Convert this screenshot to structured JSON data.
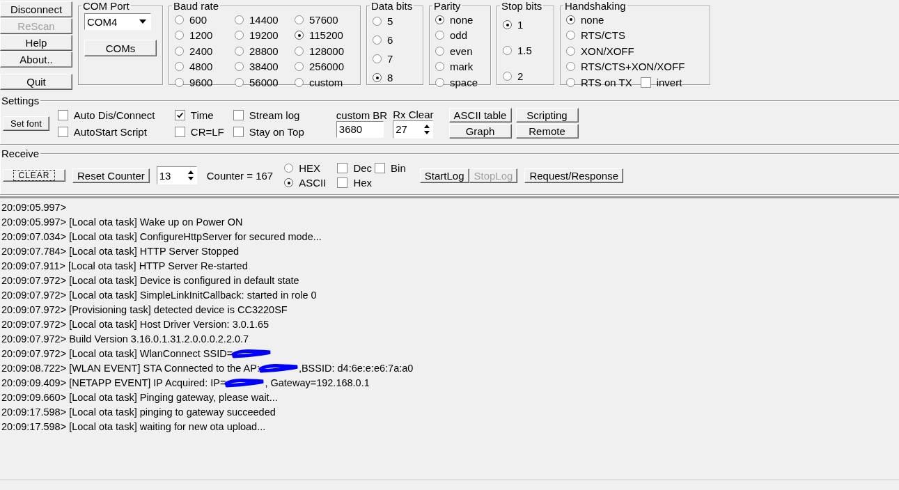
{
  "left_buttons": [
    {
      "label": "Disconnect",
      "disabled": false
    },
    {
      "label": "ReScan",
      "disabled": true
    },
    {
      "label": "Help",
      "disabled": false
    },
    {
      "label": "About..",
      "disabled": false
    },
    {
      "label": "Quit",
      "disabled": false
    }
  ],
  "com_port": {
    "title": "COM Port",
    "value": "COM4",
    "button": "COMs"
  },
  "baud_rate": {
    "title": "Baud rate",
    "options": [
      {
        "label": "600",
        "selected": false
      },
      {
        "label": "14400",
        "selected": false
      },
      {
        "label": "57600",
        "selected": false
      },
      {
        "label": "1200",
        "selected": false
      },
      {
        "label": "19200",
        "selected": false
      },
      {
        "label": "115200",
        "selected": true
      },
      {
        "label": "2400",
        "selected": false
      },
      {
        "label": "28800",
        "selected": false
      },
      {
        "label": "128000",
        "selected": false
      },
      {
        "label": "4800",
        "selected": false
      },
      {
        "label": "38400",
        "selected": false
      },
      {
        "label": "256000",
        "selected": false
      },
      {
        "label": "9600",
        "selected": false
      },
      {
        "label": "56000",
        "selected": false
      },
      {
        "label": "custom",
        "selected": false
      }
    ]
  },
  "data_bits": {
    "title": "Data bits",
    "options": [
      {
        "label": "5",
        "selected": false
      },
      {
        "label": "6",
        "selected": false
      },
      {
        "label": "7",
        "selected": false
      },
      {
        "label": "8",
        "selected": true
      }
    ]
  },
  "parity": {
    "title": "Parity",
    "options": [
      {
        "label": "none",
        "selected": true
      },
      {
        "label": "odd",
        "selected": false
      },
      {
        "label": "even",
        "selected": false
      },
      {
        "label": "mark",
        "selected": false
      },
      {
        "label": "space",
        "selected": false
      }
    ]
  },
  "stop_bits": {
    "title": "Stop bits",
    "options": [
      {
        "label": "1",
        "selected": true
      },
      {
        "label": "1.5",
        "selected": false
      },
      {
        "label": "2",
        "selected": false
      }
    ]
  },
  "handshaking": {
    "title": "Handshaking",
    "options": [
      {
        "label": "none",
        "selected": true
      },
      {
        "label": "RTS/CTS",
        "selected": false
      },
      {
        "label": "XON/XOFF",
        "selected": false
      },
      {
        "label": "RTS/CTS+XON/XOFF",
        "selected": false
      },
      {
        "label": "RTS on TX",
        "selected": false
      }
    ],
    "invert": {
      "label": "invert",
      "checked": false
    }
  },
  "settings": {
    "title": "Settings",
    "set_font": "Set font",
    "checkboxes": [
      {
        "label": "Auto Dis/Connect",
        "checked": false
      },
      {
        "label": "AutoStart Script",
        "checked": false
      },
      {
        "label": "Time",
        "checked": true
      },
      {
        "label": "CR=LF",
        "checked": false
      },
      {
        "label": "Stream log",
        "checked": false
      },
      {
        "label": "Stay on Top",
        "checked": false
      }
    ],
    "custom_br": {
      "label": "custom BR",
      "value": "3680"
    },
    "rx_clear": {
      "label": "Rx Clear",
      "value": "27"
    },
    "buttons": [
      "ASCII table",
      "Scripting",
      "Graph",
      "Remote"
    ]
  },
  "receive": {
    "title": "Receive",
    "clear": "CLEAR",
    "reset_counter": "Reset Counter",
    "counter_spin": "13",
    "counter": "Counter =  167",
    "format": [
      {
        "label": "HEX",
        "selected": false
      },
      {
        "label": "ASCII",
        "selected": true
      }
    ],
    "checkboxes": [
      {
        "label": "Dec",
        "checked": false
      },
      {
        "label": "Bin",
        "checked": false
      },
      {
        "label": "Hex",
        "checked": false
      }
    ],
    "log_buttons": [
      {
        "label": "StartLog",
        "disabled": false
      },
      {
        "label": "StopLog",
        "disabled": true
      }
    ],
    "request": "Request/Response"
  },
  "log": [
    {
      "before": "20:09:05.997>",
      "redacted": false
    },
    {
      "before": "20:09:05.997> [Local ota task] Wake up on Power ON",
      "redacted": false
    },
    {
      "before": "20:09:07.034> [Local ota task] ConfigureHttpServer for secured mode...",
      "redacted": false
    },
    {
      "before": "20:09:07.784> [Local ota task] HTTP Server Stopped",
      "redacted": false
    },
    {
      "before": "20:09:07.911> [Local ota task] HTTP Server Re-started",
      "redacted": false
    },
    {
      "before": "20:09:07.972> [Local ota task] Device is configured in default state",
      "redacted": false
    },
    {
      "before": "20:09:07.972> [Local ota task] SimpleLinkInitCallback: started in role 0",
      "redacted": false
    },
    {
      "before": "20:09:07.972> [Provisioning task] detected device is CC3220SF",
      "redacted": false
    },
    {
      "before": "20:09:07.972> [Local ota task] Host Driver Version: 3.0.1.65",
      "redacted": false
    },
    {
      "before": "20:09:07.972> Build Version 3.16.0.1.31.2.0.0.0.2.2.0.7",
      "redacted": false
    },
    {
      "before": "20:09:07.972> [Local ota task] WlanConnect SSID=",
      "redacted": true
    },
    {
      "before": "20:09:08.722> [WLAN EVENT] STA Connected to the AP:",
      "redacted": true,
      "after": ",BSSID: d4:6e:e:e6:7a:a0"
    },
    {
      "before": "20:09:09.409> [NETAPP EVENT] IP Acquired: IP=",
      "redacted": true,
      "after": ", Gateway=192.168.0.1"
    },
    {
      "before": "20:09:09.660> [Local ota task] Pinging gateway, please wait...",
      "redacted": false
    },
    {
      "before": "20:09:17.598> [Local ota task] pinging to gateway succeeded",
      "redacted": false
    },
    {
      "before": "20:09:17.598> [Local ota task] waiting for new ota upload...",
      "redacted": false
    }
  ]
}
